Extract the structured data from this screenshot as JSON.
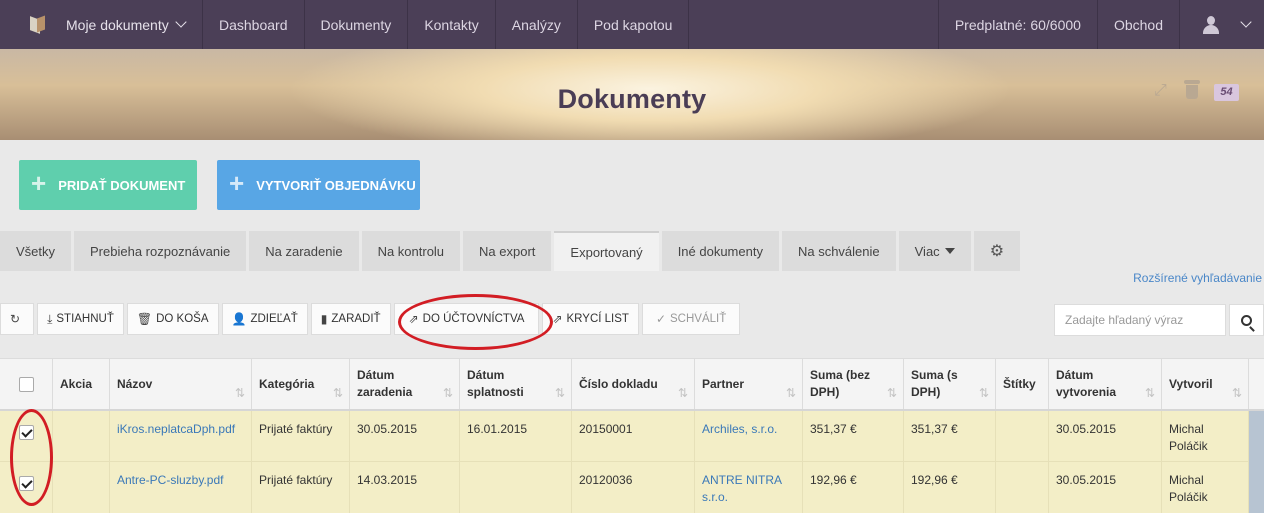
{
  "topnav": {
    "brand_label": "Moje dokumenty",
    "items": [
      "Dashboard",
      "Dokumenty",
      "Kontakty",
      "Analýzy",
      "Pod kapotou"
    ],
    "subscription": "Predplatné: 60/6000",
    "shop": "Obchod"
  },
  "banner": {
    "title": "Dokumenty",
    "trash_count": "54"
  },
  "actions": {
    "add_document": "PRIDAŤ DOKUMENT",
    "create_order": "VYTVORIŤ OBJEDNÁVKU"
  },
  "tabs": [
    "Všetky",
    "Prebieha rozpoznávanie",
    "Na zaradenie",
    "Na kontrolu",
    "Na export",
    "Exportovaný",
    "Iné dokumenty",
    "Na schválenie",
    "Viac"
  ],
  "active_tab": "Exportovaný",
  "advanced_search": "Rozšírené vyhľadávanie",
  "toolbar": {
    "download": "STIAHNUŤ",
    "to_trash": "DO KOŠA",
    "share": "ZDIEĽAŤ",
    "assign": "ZARADIŤ",
    "to_accounting": "DO ÚČTOVNÍCTVA",
    "cover_sheet": "KRYCÍ LIST",
    "approve": "SCHVÁLIŤ"
  },
  "search": {
    "placeholder": "Zadajte hľadaný výraz"
  },
  "table": {
    "headers": [
      "",
      "Akcia",
      "Názov",
      "Kategória",
      "Dátum zaradenia",
      "Dátum splatnosti",
      "Číslo dokladu",
      "Partner",
      "Suma (bez DPH)",
      "Suma (s DPH)",
      "Štítky",
      "Dátum vytvorenia",
      "Vytvoril"
    ],
    "rows": [
      {
        "checked": true,
        "action": "",
        "name": "iKros.neplatcaDph.pdf",
        "category": "Prijaté faktúry",
        "date_assigned": "30.05.2015",
        "date_due": "16.01.2015",
        "doc_number": "20150001",
        "partner": "Archiles, s.r.o.",
        "sum_net": "351,37 €",
        "sum_gross": "351,37 €",
        "tags": "",
        "date_created": "30.05.2015",
        "created_by": "Michal Poláčik"
      },
      {
        "checked": true,
        "action": "",
        "name": "Antre-PC-sluzby.pdf",
        "category": "Prijaté faktúry",
        "date_assigned": "14.03.2015",
        "date_due": "",
        "doc_number": "20120036",
        "partner": "ANTRE NITRA s.r.o.",
        "sum_net": "192,96 €",
        "sum_gross": "192,96 €",
        "tags": "",
        "date_created": "30.05.2015",
        "created_by": "Michal Poláčik"
      }
    ]
  },
  "colors": {
    "nav_bg": "#4b3f57",
    "add_btn": "#5fcfad",
    "order_btn": "#58a6e5",
    "selected_row": "#f3eec7",
    "annotation": "#d21d24"
  }
}
